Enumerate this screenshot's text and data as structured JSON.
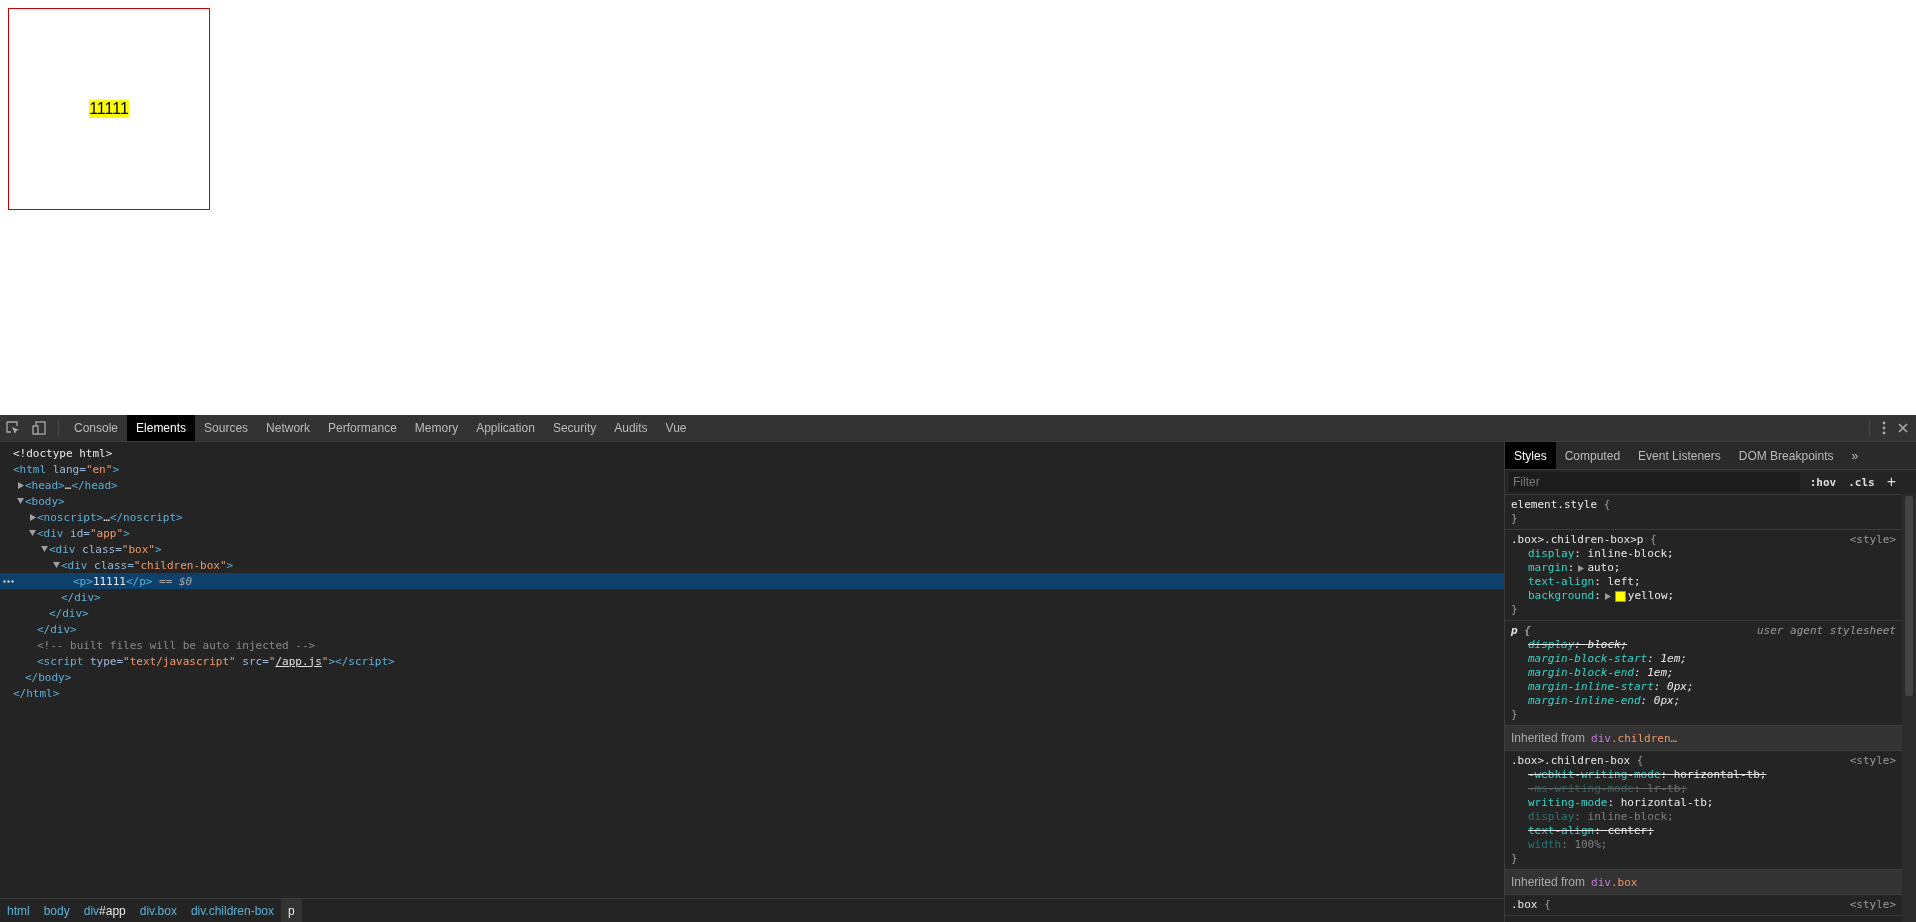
{
  "page": {
    "box_text": "11111"
  },
  "devtools": {
    "tabs": [
      {
        "label": "Console",
        "selected": false
      },
      {
        "label": "Elements",
        "selected": true
      },
      {
        "label": "Sources",
        "selected": false
      },
      {
        "label": "Network",
        "selected": false
      },
      {
        "label": "Performance",
        "selected": false
      },
      {
        "label": "Memory",
        "selected": false
      },
      {
        "label": "Application",
        "selected": false
      },
      {
        "label": "Security",
        "selected": false
      },
      {
        "label": "Audits",
        "selected": false
      },
      {
        "label": "Vue",
        "selected": false
      }
    ],
    "tree": [
      {
        "selected": false,
        "tokens": [
          {
            "kind": "doctype",
            "text": "<!doctype html>"
          }
        ]
      },
      {
        "selected": false,
        "tokens": [
          {
            "kind": "tag",
            "text": "<html"
          },
          {
            "kind": "attr",
            "text": " lang="
          },
          {
            "kind": "value",
            "text": "\"en\""
          },
          {
            "kind": "tag",
            "text": ">"
          }
        ],
        "children": [
          {
            "selected": false,
            "expanded": false,
            "tokens": [
              {
                "kind": "tag",
                "text": "<head>"
              },
              {
                "kind": "text",
                "text": "…"
              },
              {
                "kind": "tag",
                "text": "</head>"
              }
            ]
          },
          {
            "selected": false,
            "expanded": true,
            "tokens": [
              {
                "kind": "tag",
                "text": "<body>"
              }
            ],
            "children": [
              {
                "selected": false,
                "expanded": false,
                "tokens": [
                  {
                    "kind": "tag",
                    "text": "<noscript>"
                  },
                  {
                    "kind": "text",
                    "text": "…"
                  },
                  {
                    "kind": "tag",
                    "text": "</noscript>"
                  }
                ]
              },
              {
                "selected": false,
                "expanded": true,
                "tokens": [
                  {
                    "kind": "tag",
                    "text": "<div"
                  },
                  {
                    "kind": "attr",
                    "text": " id="
                  },
                  {
                    "kind": "value",
                    "text": "\"app\""
                  },
                  {
                    "kind": "tag",
                    "text": ">"
                  }
                ],
                "children": [
                  {
                    "selected": false,
                    "expanded": true,
                    "tokens": [
                      {
                        "kind": "tag",
                        "text": "<div"
                      },
                      {
                        "kind": "attr",
                        "text": " class="
                      },
                      {
                        "kind": "value",
                        "text": "\"box\""
                      },
                      {
                        "kind": "tag",
                        "text": ">"
                      }
                    ],
                    "children": [
                      {
                        "selected": false,
                        "expanded": true,
                        "tokens": [
                          {
                            "kind": "tag",
                            "text": "<div"
                          },
                          {
                            "kind": "attr",
                            "text": " class="
                          },
                          {
                            "kind": "value",
                            "text": "\"children-box\""
                          },
                          {
                            "kind": "tag",
                            "text": ">"
                          }
                        ],
                        "children": [
                          {
                            "selected": true,
                            "tokens": [
                              {
                                "kind": "tag",
                                "text": "<p>"
                              },
                              {
                                "kind": "text",
                                "text": "11111"
                              },
                              {
                                "kind": "tag",
                                "text": "</p>"
                              },
                              {
                                "kind": "marker",
                                "text": " == "
                              },
                              {
                                "kind": "marker_var",
                                "text": "$0"
                              }
                            ]
                          }
                        ],
                        "closing": [
                          {
                            "kind": "tag",
                            "text": "</div>"
                          }
                        ]
                      }
                    ],
                    "closing": [
                      {
                        "kind": "tag",
                        "text": "</div>"
                      }
                    ]
                  }
                ],
                "closing": [
                  {
                    "kind": "tag",
                    "text": "</div>"
                  }
                ]
              },
              {
                "selected": false,
                "tokens": [
                  {
                    "kind": "comment",
                    "text": "<!-- built files will be auto injected -->"
                  }
                ]
              },
              {
                "selected": false,
                "tokens": [
                  {
                    "kind": "tag",
                    "text": "<script"
                  },
                  {
                    "kind": "attr",
                    "text": " type="
                  },
                  {
                    "kind": "value",
                    "text": "\"text/javascript\""
                  },
                  {
                    "kind": "attr",
                    "text": " src="
                  },
                  {
                    "kind": "value",
                    "text": "\""
                  },
                  {
                    "kind": "link",
                    "text": "/app.js"
                  },
                  {
                    "kind": "value",
                    "text": "\""
                  },
                  {
                    "kind": "tag",
                    "text": "></script>"
                  }
                ]
              }
            ],
            "closing": [
              {
                "kind": "tag",
                "text": "</body>"
              }
            ]
          }
        ],
        "closing": [
          {
            "kind": "tag",
            "text": "</html>"
          }
        ]
      }
    ],
    "breadcrumbs": [
      {
        "selected": false,
        "parts": [
          {
            "kind": "tag",
            "text": "html"
          }
        ]
      },
      {
        "selected": false,
        "parts": [
          {
            "kind": "tag",
            "text": "body"
          }
        ]
      },
      {
        "selected": false,
        "parts": [
          {
            "kind": "tag",
            "text": "div"
          },
          {
            "kind": "id",
            "text": "#app"
          }
        ]
      },
      {
        "selected": false,
        "parts": [
          {
            "kind": "tag",
            "text": "div.box"
          }
        ]
      },
      {
        "selected": false,
        "parts": [
          {
            "kind": "tag",
            "text": "div.children-box"
          }
        ]
      },
      {
        "selected": true,
        "parts": [
          {
            "kind": "tag",
            "text": "p"
          }
        ]
      }
    ],
    "styles": {
      "tabs": [
        {
          "label": "Styles",
          "selected": true
        },
        {
          "label": "Computed",
          "selected": false
        },
        {
          "label": "Event Listeners",
          "selected": false
        },
        {
          "label": "DOM Breakpoints",
          "selected": false
        }
      ],
      "more_tabs": "»",
      "filter": {
        "placeholder": "Filter"
      },
      "hov": ":hov",
      "cls": ".cls",
      "add": "+",
      "sections": [
        {
          "kind": "rule",
          "user_agent": false,
          "selector": "element.style",
          "open": "{",
          "close": "}"
        },
        {
          "kind": "rule",
          "user_agent": false,
          "selector": ".box>.children-box>p",
          "open": "{",
          "source": "<style>",
          "close": "}",
          "declarations": [
            {
              "text": "display: inline-block;",
              "overridden": false,
              "inactive": false
            },
            {
              "text": "margin: auto;",
              "overridden": false,
              "inactive": false,
              "expandable": true
            },
            {
              "text": "text-align: left;",
              "overridden": false,
              "inactive": false
            },
            {
              "text": "background: yellow;",
              "overridden": false,
              "inactive": false,
              "expandable": true,
              "color": "#ffff00"
            }
          ]
        },
        {
          "kind": "rule",
          "user_agent": true,
          "selector": "p",
          "open": "{",
          "source": "user agent stylesheet",
          "close": "}",
          "declarations": [
            {
              "text": "display: block;",
              "overridden": true,
              "inactive": false
            },
            {
              "text": "margin-block-start: 1em;",
              "overridden": false,
              "inactive": false
            },
            {
              "text": "margin-block-end: 1em;",
              "overridden": false,
              "inactive": false
            },
            {
              "text": "margin-inline-start: 0px;",
              "overridden": false,
              "inactive": false
            },
            {
              "text": "margin-inline-end: 0px;",
              "overridden": false,
              "inactive": false
            }
          ]
        },
        {
          "kind": "inherited",
          "label": "Inherited from",
          "element": "div.children…"
        },
        {
          "kind": "rule",
          "user_agent": false,
          "selector": ".box>.children-box",
          "open": "{",
          "source": "<style>",
          "close": "}",
          "declarations": [
            {
              "text": "-webkit-writing-mode: horizontal-tb;",
              "overridden": true,
              "inactive": false
            },
            {
              "text": "-ms-writing-mode: lr-tb;",
              "overridden": true,
              "inactive": true
            },
            {
              "text": "writing-mode: horizontal-tb;",
              "overridden": false,
              "inactive": false
            },
            {
              "text": "display: inline-block;",
              "overridden": false,
              "inactive": true
            },
            {
              "text": "text-align: center;",
              "overridden": true,
              "inactive": false
            },
            {
              "text": "width: 100%;",
              "overridden": false,
              "inactive": true
            }
          ]
        },
        {
          "kind": "inherited",
          "label": "Inherited from",
          "element": "div.box"
        },
        {
          "kind": "rule",
          "user_agent": false,
          "selector": ".box",
          "open": "{",
          "source": "<style>"
        }
      ]
    }
  }
}
